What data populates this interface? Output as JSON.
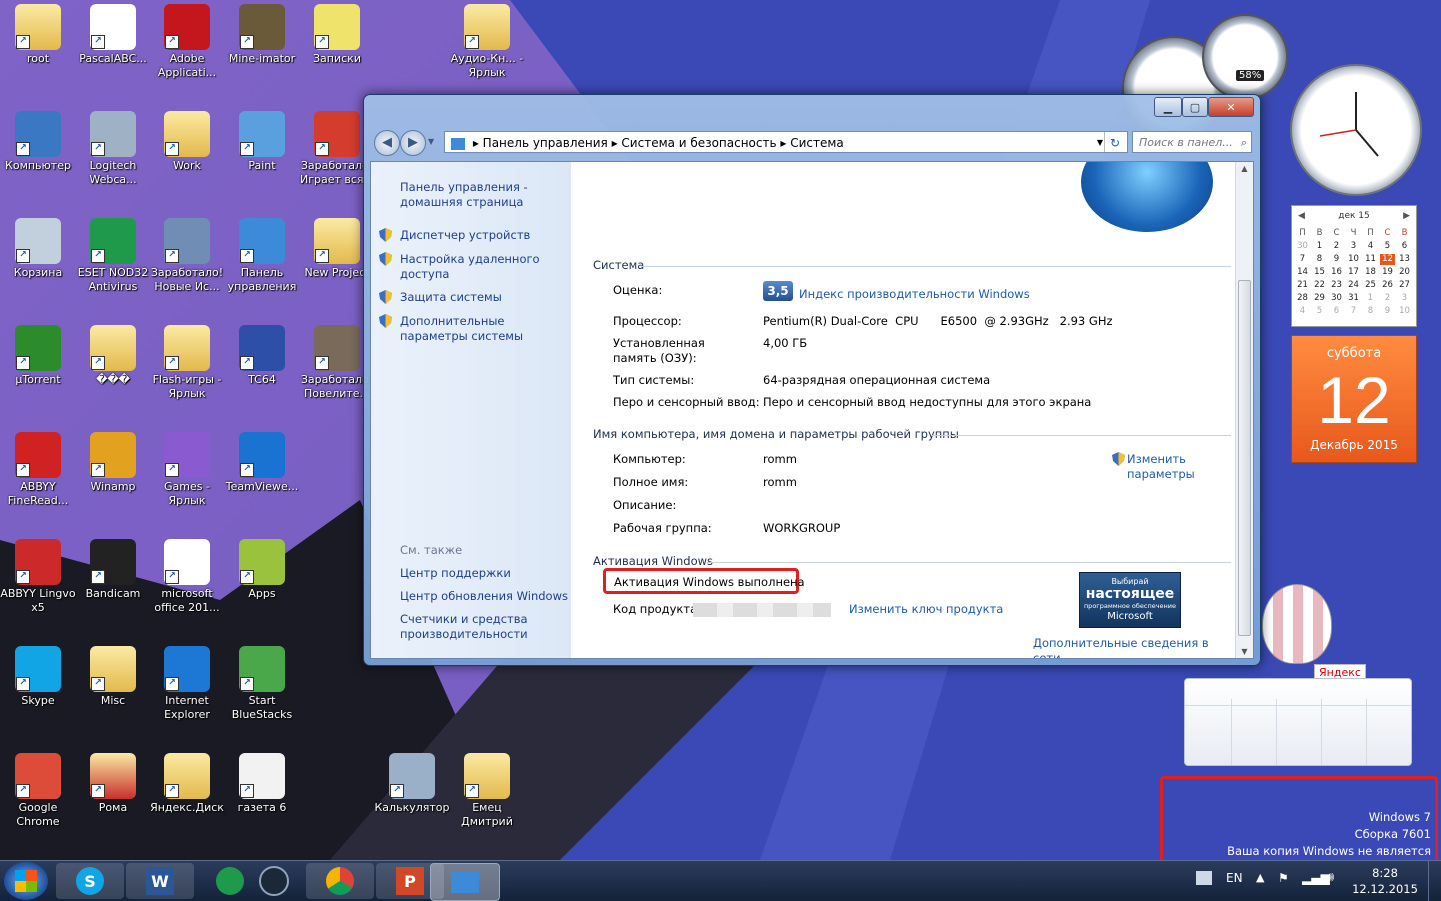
{
  "desktop": {
    "icons": [
      {
        "label": "root",
        "icon": "user-folder-icon",
        "color": "#e3b94c"
      },
      {
        "label": "PascalABC...",
        "icon": "pascalabc-icon",
        "color": "#ffffff"
      },
      {
        "label": "Adobe Applicati...",
        "icon": "adobe-icon",
        "color": "#c4171d"
      },
      {
        "label": "Mine-imator",
        "icon": "mine-imator-icon",
        "color": "#6a5a3a"
      },
      {
        "label": "Записки",
        "icon": "sticky-notes-icon",
        "color": "#f0e36b"
      },
      {
        "label": "Аудио-Кн... - Ярлык",
        "icon": "audio-folder-icon",
        "color": "#e3b94c"
      },
      {
        "label": "Компьютер",
        "icon": "computer-icon",
        "color": "#3a78c4"
      },
      {
        "label": "Logitech Webca...",
        "icon": "webcam-icon",
        "color": "#9fb1c4"
      },
      {
        "label": "Work",
        "icon": "folder-icon",
        "color": "#e3b94c"
      },
      {
        "label": "Paint",
        "icon": "paint-icon",
        "color": "#5aa0de"
      },
      {
        "label": "Заработало! Играет вся...",
        "icon": "game-icon",
        "color": "#d43c2e"
      },
      {
        "label": "Корзина",
        "icon": "recycle-bin-icon",
        "color": "#c2cfdd"
      },
      {
        "label": "ESET NOD32 Antivirus",
        "icon": "eset-icon",
        "color": "#1f9a4a"
      },
      {
        "label": "Заработало! Новые Ис...",
        "icon": "robot-icon",
        "color": "#6f8db5"
      },
      {
        "label": "Панель управления",
        "icon": "control-panel-icon",
        "color": "#3d8ad8"
      },
      {
        "label": "New Project",
        "icon": "folder-icon",
        "color": "#e3b94c"
      },
      {
        "label": "µTorrent",
        "icon": "utorrent-icon",
        "color": "#2c8c2c"
      },
      {
        "label": "���",
        "icon": "folder-icon",
        "color": "#e3b94c"
      },
      {
        "label": "Flash-игры - Ярлык",
        "icon": "folder-icon",
        "color": "#e3b94c"
      },
      {
        "label": "TC64",
        "icon": "tc64-icon",
        "color": "#2d4fa8"
      },
      {
        "label": "Заработало! Повелите...",
        "icon": "game-icon",
        "color": "#7a6a5a"
      },
      {
        "label": "ABBYY FineRead...",
        "icon": "abbyy-icon",
        "color": "#d02222"
      },
      {
        "label": "Winamp",
        "icon": "winamp-icon",
        "color": "#e2a11f"
      },
      {
        "label": "Games - Ярлык",
        "icon": "games-icon",
        "color": "#8a5ad0"
      },
      {
        "label": "TeamViewe...",
        "icon": "teamviewer-icon",
        "color": "#1a73d0"
      },
      {
        "label": "ABBYY Lingvo x5",
        "icon": "lingvo-icon",
        "color": "#cc2a2a"
      },
      {
        "label": "Bandicam",
        "icon": "bandicam-icon",
        "color": "#222222"
      },
      {
        "label": "microsoft office 201...",
        "icon": "office-icon",
        "color": "#ffffff"
      },
      {
        "label": "Apps",
        "icon": "android-apps-icon",
        "color": "#9bc23c"
      },
      {
        "label": "Skype",
        "icon": "skype-icon",
        "color": "#12a5e6"
      },
      {
        "label": "Misc",
        "icon": "folder-icon",
        "color": "#e3b94c"
      },
      {
        "label": "Internet Explorer",
        "icon": "ie-icon",
        "color": "#1c78d4"
      },
      {
        "label": "Start BlueStacks",
        "icon": "bluestacks-icon",
        "color": "#4aa84a"
      },
      {
        "label": "Google Chrome",
        "icon": "chrome-icon",
        "color": "#dd4b39"
      },
      {
        "label": "Рома",
        "icon": "folder-icon",
        "color": "#c7302a"
      },
      {
        "label": "Яндекс.Диск",
        "icon": "yandex-disk-icon",
        "color": "#e3b94c"
      },
      {
        "label": "газета 6",
        "icon": "word-doc-icon",
        "color": "#f2f2f2"
      },
      {
        "label": "Калькулятор",
        "icon": "calculator-icon",
        "color": "#9ab0c8"
      },
      {
        "label": "Емец Дмитрий",
        "icon": "folder-icon",
        "color": "#e3b94c"
      }
    ]
  },
  "window": {
    "breadcrumb": [
      "Панель управления",
      "Система и безопасность",
      "Система"
    ],
    "search_placeholder": "Поиск в панел...",
    "left": {
      "home_link": "Панель управления - домашняя страница",
      "tasks": [
        "Диспетчер устройств",
        "Настройка удаленного доступа",
        "Защита системы",
        "Дополнительные параметры системы"
      ],
      "see_also_header": "См. также",
      "see_also": [
        "Центр поддержки",
        "Центр обновления Windows",
        "Счетчики и средства производительности"
      ]
    },
    "system": {
      "title": "Система",
      "rating_label": "Оценка:",
      "rating_value": "3,5",
      "rating_link": "Индекс производительности Windows",
      "cpu_label": "Процессор:",
      "cpu_value": "Pentium(R) Dual-Core  CPU      E6500  @ 2.93GHz   2.93 GHz",
      "ram_label": "Установленная память (ОЗУ):",
      "ram_value": "4,00 ГБ",
      "type_label": "Тип системы:",
      "type_value": "64-разрядная операционная система",
      "pen_label": "Перо и сенсорный ввод:",
      "pen_value": "Перо и сенсорный ввод недоступны для этого экрана"
    },
    "computer": {
      "title": "Имя компьютера, имя домена и параметры рабочей группы",
      "computer_label": "Компьютер:",
      "computer_value": "romm",
      "fullname_label": "Полное имя:",
      "fullname_value": "romm",
      "desc_label": "Описание:",
      "workgroup_label": "Рабочая группа:",
      "workgroup_value": "WORKGROUP",
      "change_link": "Изменить параметры"
    },
    "activation": {
      "title": "Активация Windows",
      "status": "Активация Windows выполнена",
      "key_label": "Код продукта:",
      "change_key_link": "Изменить ключ продукта",
      "more_link": "Дополнительные сведения в сети...",
      "badge_small": "Выбирай",
      "badge_big": "настоящее",
      "badge_sub": "программное обеспечение",
      "badge_brand": "Microsoft"
    }
  },
  "gadgets": {
    "cpu_meter_percent": "58%",
    "calendar": {
      "month": "дек 15",
      "weekdays": [
        "П",
        "В",
        "С",
        "Ч",
        "П",
        "С",
        "В"
      ],
      "weeks": [
        [
          "30",
          "1",
          "2",
          "3",
          "4",
          "5",
          "6"
        ],
        [
          "7",
          "8",
          "9",
          "10",
          "11",
          "12",
          "13"
        ],
        [
          "14",
          "15",
          "16",
          "17",
          "18",
          "19",
          "20"
        ],
        [
          "21",
          "22",
          "23",
          "24",
          "25",
          "26",
          "27"
        ],
        [
          "28",
          "29",
          "30",
          "31",
          "1",
          "2",
          "3"
        ],
        [
          "4",
          "5",
          "6",
          "7",
          "8",
          "9",
          "10"
        ]
      ],
      "day_name": "суббота",
      "day": "12",
      "month_year": "Декабрь 2015"
    },
    "yandex_label": "Яндекс"
  },
  "watermark": {
    "line1": "Windows 7",
    "line2": "Сборка 7601",
    "line3": "Ваша копия Windows не является подлинной"
  },
  "taskbar": {
    "lang": "EN",
    "time": "8:28",
    "date": "12.12.2015"
  },
  "colors": {
    "desktop_purple": "#7f63c6",
    "desktop_blue": "#3a49b5",
    "highlight_red": "#e02020",
    "link_blue": "#1e5aa8"
  }
}
